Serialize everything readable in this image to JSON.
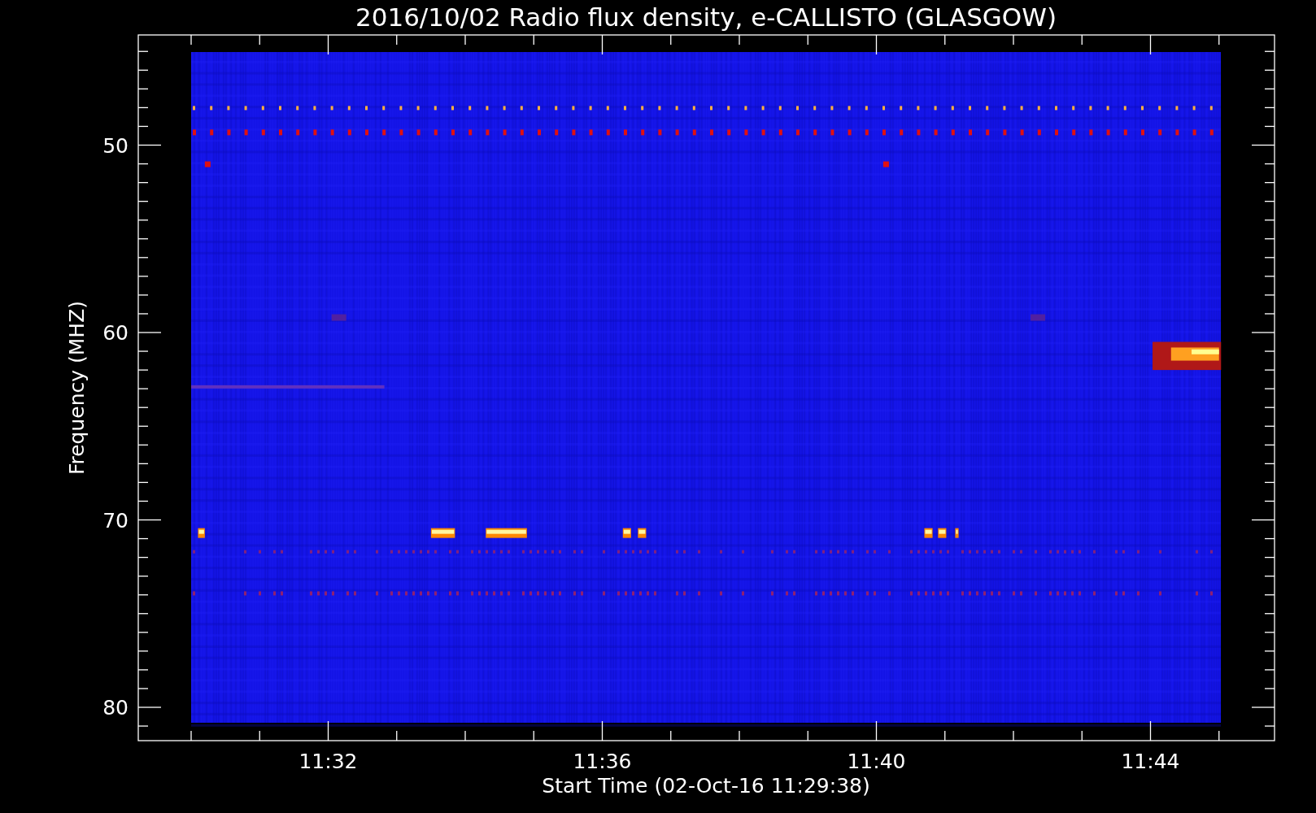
{
  "plot": {
    "title": "2016/10/02  Radio flux density, e-CALLISTO (GLASGOW)",
    "ylabel": "Frequency (MHZ)",
    "xlabel": "Start Time (02-Oct-16 11:29:38)",
    "y_tick_labels": [
      "50",
      "60",
      "70",
      "80"
    ],
    "x_tick_labels": [
      "11:32",
      "11:36",
      "11:40",
      "11:44"
    ]
  }
}
